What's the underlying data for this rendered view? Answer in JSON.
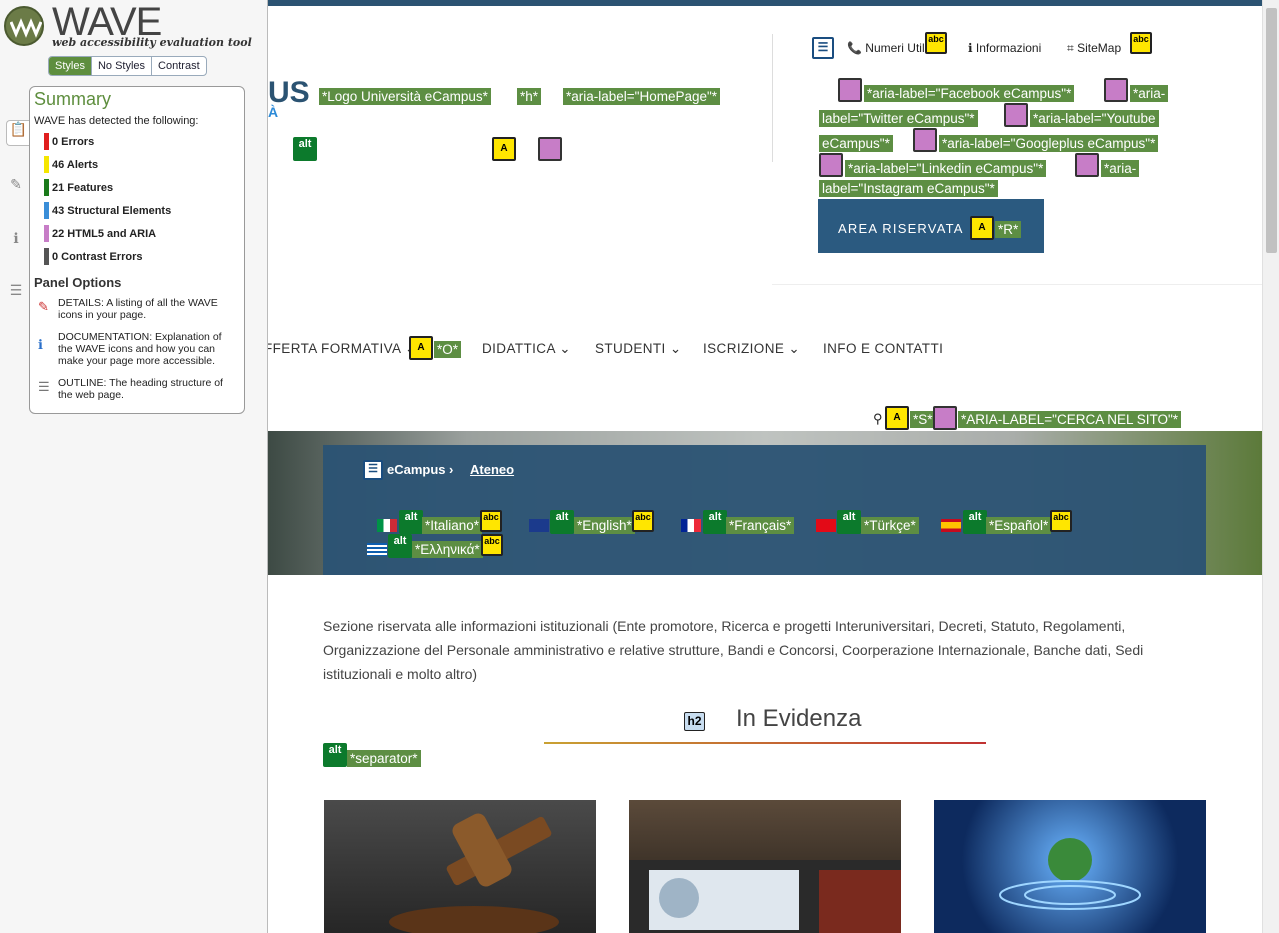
{
  "wave": {
    "title": "WAVE",
    "subtitle": "web accessibility evaluation tool",
    "view_buttons": [
      "Styles",
      "No Styles",
      "Contrast"
    ],
    "summary_title": "Summary",
    "detected": "WAVE has detected the following:",
    "stats": [
      {
        "label": "0 Errors",
        "color": "#e01e1e"
      },
      {
        "label": "46 Alerts",
        "color": "#f5e600"
      },
      {
        "label": "21 Features",
        "color": "#1a7a1a"
      },
      {
        "label": "43 Structural Elements",
        "color": "#3a8ed8"
      },
      {
        "label": "22 HTML5 and ARIA",
        "color": "#c77dc7"
      },
      {
        "label": "0 Contrast Errors",
        "color": "#555555"
      }
    ],
    "panel_options_title": "Panel Options",
    "options": [
      "DETAILS: A listing of all the WAVE icons in your page.",
      "DOCUMENTATION: Explanation of the WAVE icons and how you can make your page more accessible.",
      "OUTLINE: The heading structure of the web page."
    ]
  },
  "header": {
    "logo_partial": "US",
    "logo_partial2": "À",
    "logo_labels": [
      "*Logo Università eCampus*",
      "*h*",
      "*aria-label=\"HomePage\"*"
    ],
    "top_links": [
      "Numeri Utili",
      "Informazioni",
      "SiteMap"
    ],
    "social_labels": [
      "*aria-label=\"Facebook eCampus\"*",
      "*aria-",
      "label=\"Twitter eCampus\"*",
      "*aria-label=\"Youtube",
      "eCampus\"*",
      "*aria-label=\"Googleplus eCampus\"*",
      "*aria-label=\"Linkedin eCampus\"*",
      "*aria-",
      "label=\"Instagram eCampus\"*"
    ],
    "area_riservata": "AREA RISERVATA",
    "area_label": "*R*"
  },
  "nav": {
    "items": [
      "FFERTA FORMATIVA",
      "DIDATTICA",
      "STUDENTI",
      "ISCRIZIONE",
      "INFO E CONTATTI"
    ],
    "offerta_label": "*O*",
    "search_labels": [
      "*S*",
      "*ARIA-LABEL=\"CERCA NEL SITO\"*"
    ]
  },
  "hero": {
    "breadcrumb": [
      "eCampus",
      "Ateneo"
    ],
    "languages": [
      "*Italiano*",
      "*English*",
      "*Français*",
      "*Türkçe*",
      "*Español*",
      "*Ελληνικά*"
    ]
  },
  "content": {
    "intro": "Sezione riservata alle informazioni istituzionali (Ente promotore, Ricerca e progetti Interuniversitari, Decreti, Statuto, Regolamenti, Organizzazione del Personale amministrativo e relative strutture, Bandi e Concorsi, Coorperazione Internazionale, Banche dati, Sedi istituzionali e molto altro)",
    "heading": "In Evidenza",
    "h2_tag": "h2",
    "separator_label": "*separator*"
  },
  "icons": {
    "alt": "alt",
    "abc": "abc",
    "a": "A"
  }
}
